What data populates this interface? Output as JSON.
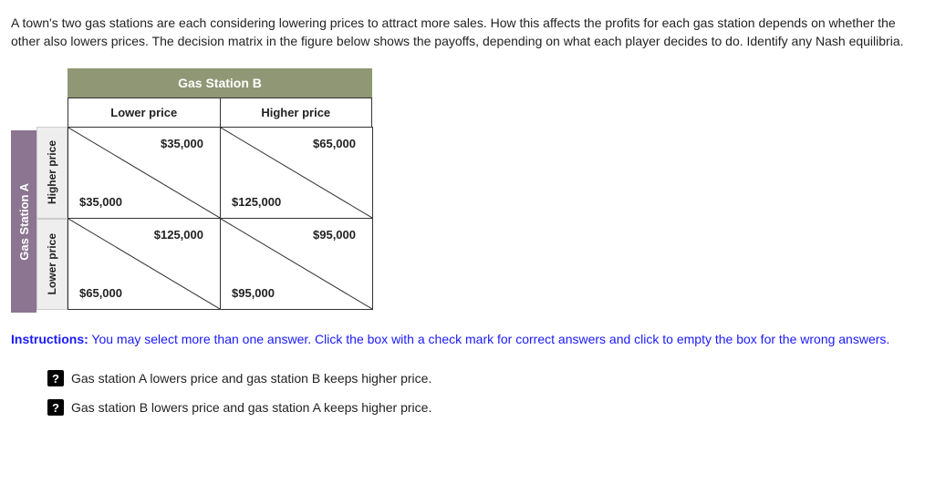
{
  "question": "A town's two gas stations are each considering lowering prices to attract more sales. How this affects the profits for each gas station depends on whether the other also lowers prices. The decision matrix in the figure below shows the payoffs, depending on what each player decides to do. Identify any Nash equilibria.",
  "matrix": {
    "playerA": "Gas Station A",
    "playerB": "Gas Station B",
    "colHeaders": [
      "Lower price",
      "Higher price"
    ],
    "rowHeaders": [
      "Higher price",
      "Lower price"
    ],
    "cells": [
      [
        {
          "top": "$35,000",
          "bottom": "$35,000"
        },
        {
          "top": "$65,000",
          "bottom": "$125,000"
        }
      ],
      [
        {
          "top": "$125,000",
          "bottom": "$65,000"
        },
        {
          "top": "$95,000",
          "bottom": "$95,000"
        }
      ]
    ]
  },
  "instructionsLabel": "Instructions:",
  "instructionsText": " You may select more than one answer. Click the box with a check mark for correct answers and click to empty the box for the wrong answers.",
  "checkboxGlyph": "?",
  "answers": [
    "Gas station A lowers price and gas station B keeps higher price.",
    "Gas station B lowers price and gas station A keeps higher price."
  ]
}
